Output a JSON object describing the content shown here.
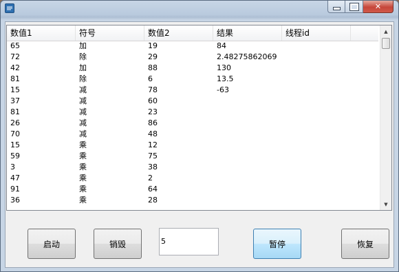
{
  "window": {
    "title": "",
    "colors": {
      "close": "#c6463a",
      "accent_button": "#bee6fd"
    }
  },
  "list": {
    "columns": [
      "数值1",
      "符号",
      "数值2",
      "结果",
      "线程id"
    ],
    "rows": [
      [
        "65",
        "加",
        "19",
        "84",
        ""
      ],
      [
        "72",
        "除",
        "29",
        "2.48275862069",
        ""
      ],
      [
        "42",
        "加",
        "88",
        "130",
        ""
      ],
      [
        "81",
        "除",
        "6",
        "13.5",
        ""
      ],
      [
        "15",
        "减",
        "78",
        "-63",
        ""
      ],
      [
        "37",
        "减",
        "60",
        "",
        ""
      ],
      [
        "81",
        "减",
        "23",
        "",
        ""
      ],
      [
        "26",
        "减",
        "86",
        "",
        ""
      ],
      [
        "70",
        "减",
        "48",
        "",
        ""
      ],
      [
        "15",
        "乘",
        "12",
        "",
        ""
      ],
      [
        "59",
        "乘",
        "75",
        "",
        ""
      ],
      [
        "3",
        "乘",
        "38",
        "",
        ""
      ],
      [
        "47",
        "乘",
        "2",
        "",
        ""
      ],
      [
        "91",
        "乘",
        "64",
        "",
        ""
      ],
      [
        "36",
        "乘",
        "28",
        "",
        ""
      ]
    ]
  },
  "buttons": {
    "start": "启动",
    "destroy": "销毁",
    "pause": "暂停",
    "resume": "恢复"
  },
  "input": {
    "value": "5"
  }
}
